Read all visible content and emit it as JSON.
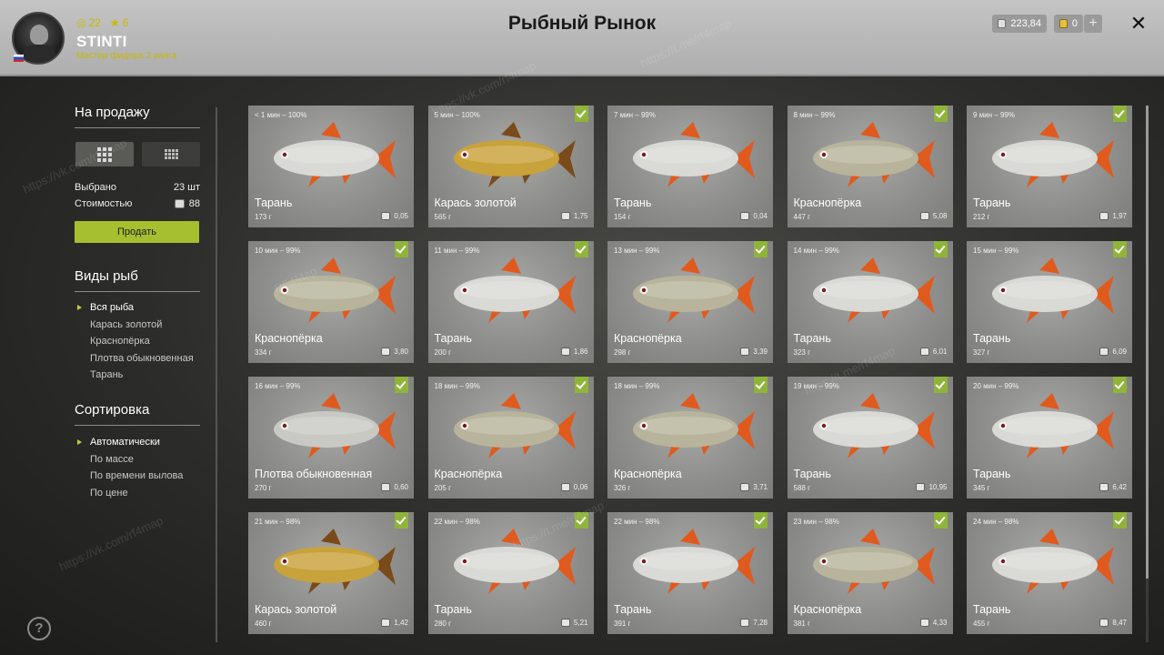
{
  "player": {
    "stat_a": "22",
    "stat_b": "6",
    "name": "STINTI",
    "rank": "Мастер фидера 2 ранга"
  },
  "title": "Рыбный Рынок",
  "currency": {
    "silver": "223,84",
    "gold": "0"
  },
  "sidebar": {
    "for_sale_title": "На продажу",
    "selected_label": "Выбрано",
    "selected_value": "23 шт",
    "cost_label": "Стоимостью",
    "cost_value": "88",
    "sell_label": "Продать",
    "species_title": "Виды рыб",
    "species": [
      "Вся рыба",
      "Карась золотой",
      "Краснопёрка",
      "Плотва обыкновенная",
      "Тарань"
    ],
    "species_selected": 0,
    "sort_title": "Сортировка",
    "sorts": [
      "Автоматически",
      "По массе",
      "По времени вылова",
      "По цене"
    ],
    "sort_selected": 0,
    "help": "?"
  },
  "fish_colors": {
    "Тарань": "#d9d9d6",
    "Карась золотой": "#c8a23a",
    "Краснопёрка": "#b8b49c",
    "Плотва обыкновенная": "#c9c9c4"
  },
  "cards": [
    {
      "time": "< 1 мин – 100%",
      "name": "Тарань",
      "weight": "173 г",
      "price": "0,05",
      "checked": false
    },
    {
      "time": "5 мин – 100%",
      "name": "Карась золотой",
      "weight": "565 г",
      "price": "1,75",
      "checked": true
    },
    {
      "time": "7 мин – 99%",
      "name": "Тарань",
      "weight": "154 г",
      "price": "0,04",
      "checked": false
    },
    {
      "time": "8 мин – 99%",
      "name": "Краснопёрка",
      "weight": "447 г",
      "price": "5,08",
      "checked": true
    },
    {
      "time": "9 мин – 99%",
      "name": "Тарань",
      "weight": "212 г",
      "price": "1,97",
      "checked": true
    },
    {
      "time": "10 мин – 99%",
      "name": "Краснопёрка",
      "weight": "334 г",
      "price": "3,80",
      "checked": true
    },
    {
      "time": "11 мин – 99%",
      "name": "Тарань",
      "weight": "200 г",
      "price": "1,86",
      "checked": true
    },
    {
      "time": "13 мин – 99%",
      "name": "Краснопёрка",
      "weight": "298 г",
      "price": "3,39",
      "checked": true
    },
    {
      "time": "14 мин – 99%",
      "name": "Тарань",
      "weight": "323 г",
      "price": "6,01",
      "checked": true
    },
    {
      "time": "15 мин – 99%",
      "name": "Тарань",
      "weight": "327 г",
      "price": "6,09",
      "checked": true
    },
    {
      "time": "16 мин – 99%",
      "name": "Плотва обыкновенная",
      "weight": "270 г",
      "price": "0,60",
      "checked": true
    },
    {
      "time": "18 мин – 99%",
      "name": "Краснопёрка",
      "weight": "205 г",
      "price": "0,06",
      "checked": true
    },
    {
      "time": "18 мин – 99%",
      "name": "Краснопёрка",
      "weight": "326 г",
      "price": "3,71",
      "checked": true
    },
    {
      "time": "19 мин – 99%",
      "name": "Тарань",
      "weight": "588 г",
      "price": "10,95",
      "checked": true
    },
    {
      "time": "20 мин – 99%",
      "name": "Тарань",
      "weight": "345 г",
      "price": "6,42",
      "checked": true
    },
    {
      "time": "21 мин – 98%",
      "name": "Карась золотой",
      "weight": "460 г",
      "price": "1,42",
      "checked": true
    },
    {
      "time": "22 мин – 98%",
      "name": "Тарань",
      "weight": "280 г",
      "price": "5,21",
      "checked": true
    },
    {
      "time": "22 мин – 98%",
      "name": "Тарань",
      "weight": "391 г",
      "price": "7,28",
      "checked": true
    },
    {
      "time": "23 мин – 98%",
      "name": "Краснопёрка",
      "weight": "381 г",
      "price": "4,33",
      "checked": true
    },
    {
      "time": "24 мин – 98%",
      "name": "Тарань",
      "weight": "455 г",
      "price": "8,47",
      "checked": true
    }
  ],
  "watermarks": [
    "RF4Map",
    "https://vk.com/rf4map",
    "https://t.me/rf4map"
  ]
}
